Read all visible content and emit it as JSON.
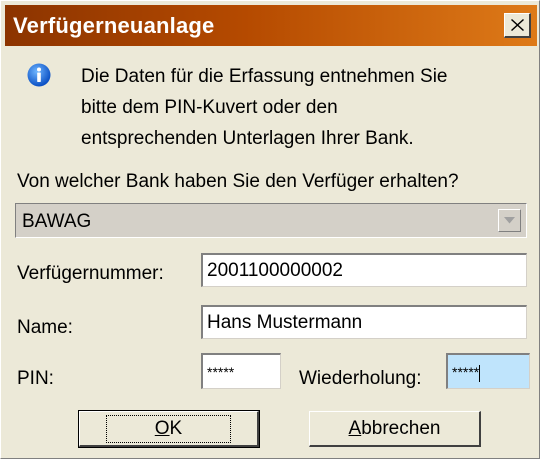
{
  "window": {
    "title": "Verfügerneuanlage",
    "close_icon": "close-icon"
  },
  "info": {
    "icon": "info-icon",
    "lines": [
      "Die Daten für die Erfassung entnehmen Sie",
      "bitte dem PIN-Kuvert oder den",
      "entsprechenden Unterlagen Ihrer Bank."
    ]
  },
  "bank": {
    "question": "Von welcher Bank haben Sie den Verfüger erhalten?",
    "selected": "BAWAG"
  },
  "fields": {
    "number_label": "Verfügernummer:",
    "number_value": "2001100000002",
    "name_label": "Name:",
    "name_value": "Hans Mustermann",
    "pin_label": "PIN:",
    "pin_value": "*****",
    "repeat_label": "Wiederholung:",
    "repeat_value": "*****"
  },
  "buttons": {
    "ok_mnemonic": "O",
    "ok_rest": "K",
    "cancel_mnemonic": "A",
    "cancel_rest": "bbrechen"
  },
  "colors": {
    "title_gradient_start": "#8c3400",
    "title_gradient_end": "#de7a18",
    "focused_field": "#bfe4fc",
    "dialog_bg": "#ece9d8"
  }
}
